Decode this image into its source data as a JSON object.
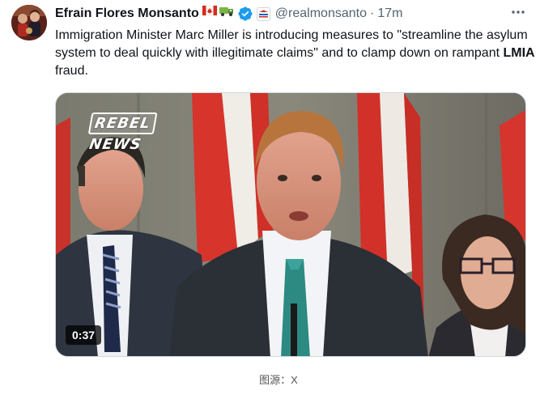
{
  "author": {
    "display_name": "Efrain Flores Monsanto",
    "emoji": "🇨🇦🚛",
    "handle": "@realmonsanto",
    "separator": "·",
    "timestamp": "17m"
  },
  "tweet": {
    "text_before": "Immigration Minister Marc Miller is introducing measures to \"streamline the asylum system to deal quickly with illegitimate claims\" and to clamp down on rampant ",
    "text_bold": "LMIA",
    "text_after": " fraud."
  },
  "media": {
    "watermark_line1": "REBEL",
    "watermark_line2": "NEWS",
    "duration": "0:37"
  },
  "caption": "图源：X",
  "icons": {
    "verified": "verified-badge-icon",
    "affiliate": "affiliate-badge-icon",
    "more": "more-options-icon"
  },
  "colors": {
    "verified_blue": "#1d9bf0",
    "secondary_text": "#536471",
    "primary_text": "#0f1419"
  }
}
